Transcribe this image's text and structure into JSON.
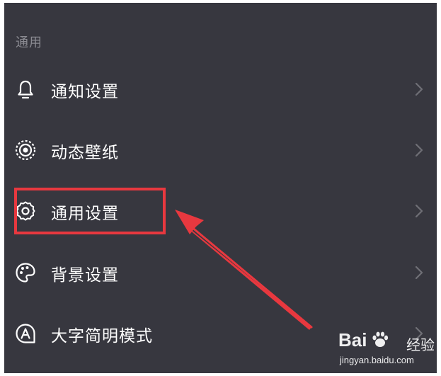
{
  "section": {
    "title": "通用"
  },
  "menu": {
    "items": [
      {
        "label": "通知设置",
        "icon": "bell-icon"
      },
      {
        "label": "动态壁纸",
        "icon": "live-wallpaper-icon"
      },
      {
        "label": "通用设置",
        "icon": "gear-icon",
        "highlighted": true
      },
      {
        "label": "背景设置",
        "icon": "palette-icon"
      },
      {
        "label": "大字简明模式",
        "icon": "large-font-icon"
      }
    ]
  },
  "annotation": {
    "highlight_color": "#e8383f",
    "arrow_color": "#e8383f"
  },
  "watermark": {
    "brand": "Bai",
    "brand_suffix": "经验",
    "url": "jingyan.baidu.com"
  },
  "colors": {
    "panel_background": "#37373f",
    "text": "#ffffff",
    "section_title": "#8b8b92",
    "chevron": "#6f6f76"
  }
}
